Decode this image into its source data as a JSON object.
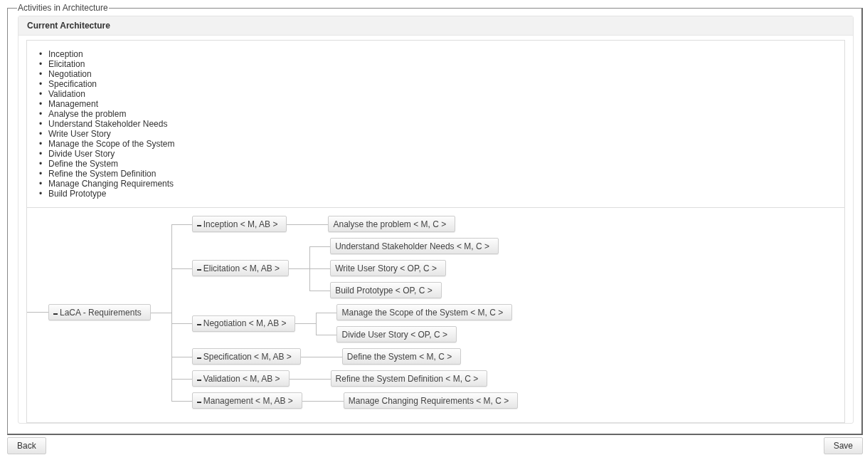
{
  "section": {
    "title": "Activities in Architecture"
  },
  "panel": {
    "title": "Current Architecture",
    "activities": [
      {
        "bullet": "•",
        "text": "Inception"
      },
      {
        "bullet": "•",
        "text": "Elicitation"
      },
      {
        "bullet": "•",
        "text": "Negotiation"
      },
      {
        "bullet": "•",
        "text": "Specification"
      },
      {
        "bullet": "•",
        "text": "Validation"
      },
      {
        "bullet": "•",
        "text": "Management"
      },
      {
        "bullet": "•",
        "text": "Analyse the problem"
      },
      {
        "bullet": "•",
        "text": "Understand Stakeholder Needs"
      },
      {
        "bullet": "•",
        "text": "Write User Story"
      },
      {
        "bullet": "•",
        "text": "Manage the Scope of the System"
      },
      {
        "bullet": "•",
        "text": "Divide User Story"
      },
      {
        "bullet": "•",
        "text": "Define the System"
      },
      {
        "bullet": "•",
        "text": "Refine the System Definition"
      },
      {
        "bullet": "•",
        "text": "Manage Changing Requirements"
      },
      {
        "bullet": "•",
        "text": "Build Prototype"
      }
    ],
    "tree": {
      "label": "LaCA - Requirements",
      "expanded": true,
      "children": [
        {
          "label": "Inception < M, AB >",
          "expanded": true,
          "children": [
            {
              "label": "Analyse the problem < M, C >"
            }
          ]
        },
        {
          "label": "Elicitation < M, AB >",
          "expanded": true,
          "children": [
            {
              "label": "Understand Stakeholder Needs < M, C >"
            },
            {
              "label": "Write User Story < OP, C >"
            },
            {
              "label": "Build Prototype < OP, C >"
            }
          ]
        },
        {
          "label": "Negotiation < M, AB >",
          "expanded": true,
          "children": [
            {
              "label": "Manage the Scope of the System < M, C >"
            },
            {
              "label": "Divide User Story < OP, C >"
            }
          ]
        },
        {
          "label": "Specification < M, AB >",
          "expanded": true,
          "children": [
            {
              "label": "Define the System < M, C >"
            }
          ]
        },
        {
          "label": "Validation < M, AB >",
          "expanded": true,
          "children": [
            {
              "label": "Refine the System Definition < M, C >"
            }
          ]
        },
        {
          "label": "Management < M, AB >",
          "expanded": true,
          "children": [
            {
              "label": "Manage Changing Requirements < M, C >"
            }
          ]
        }
      ]
    }
  },
  "buttons": [
    {
      "label": "Back"
    },
    {
      "label": "Save"
    }
  ]
}
